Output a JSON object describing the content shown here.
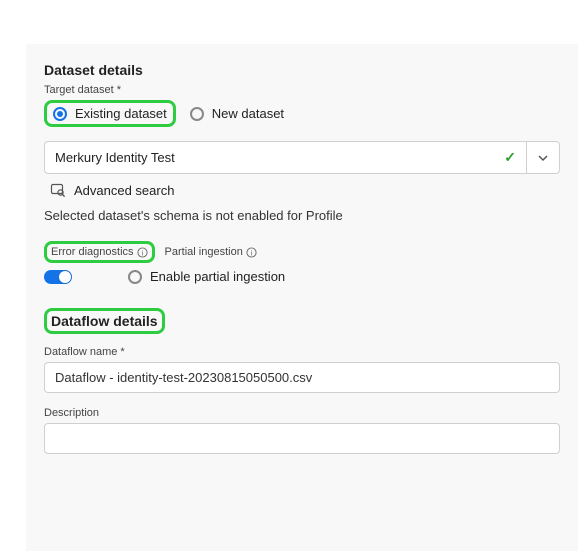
{
  "dataset": {
    "section_title": "Dataset details",
    "target_label": "Target dataset",
    "radio_existing": "Existing dataset",
    "radio_new": "New dataset",
    "selected_value": "Merkury Identity Test",
    "advanced_search": "Advanced search",
    "schema_note": "Selected dataset's schema is not enabled for Profile"
  },
  "diagnostics": {
    "error_label": "Error diagnostics",
    "partial_label": "Partial ingestion",
    "enable_partial": "Enable partial ingestion"
  },
  "dataflow": {
    "section_title": "Dataflow details",
    "name_label": "Dataflow name",
    "name_value": "Dataflow - identity-test-20230815050500.csv",
    "description_label": "Description",
    "description_value": ""
  }
}
